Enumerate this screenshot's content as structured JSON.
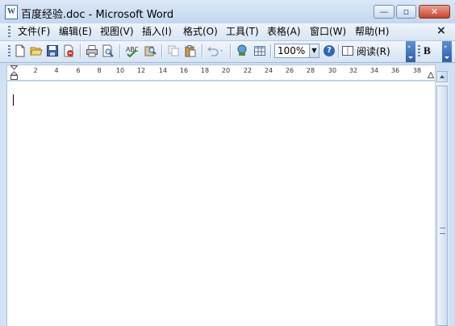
{
  "window": {
    "app_icon_letter": "W",
    "title": "百度经验.doc - Microsoft Word",
    "min_glyph": "—",
    "max_glyph": "▫",
    "close_glyph": "✕"
  },
  "menu": {
    "items": [
      "文件(F)",
      "编辑(E)",
      "视图(V)",
      "插入(I)",
      "格式(O)",
      "工具(T)",
      "表格(A)",
      "窗口(W)",
      "帮助(H)"
    ],
    "close_glyph": "×"
  },
  "toolbar": {
    "zoom_value": "100%",
    "zoom_arrow": "▼",
    "help_glyph": "?",
    "read_label": "阅读(R)",
    "bold_label": "B",
    "icons": [
      "new-document-icon",
      "open-icon",
      "save-icon",
      "permission-icon",
      "print-icon",
      "print-preview-icon",
      "spelling-icon",
      "research-icon",
      "copy-icon",
      "paste-icon",
      "undo-icon",
      "hyperlink-icon",
      "table-icon"
    ]
  },
  "ruler": {
    "ticks": [
      "2",
      "4",
      "6",
      "8",
      "10",
      "12",
      "14",
      "16",
      "18",
      "20",
      "22",
      "24",
      "26",
      "28",
      "30",
      "32",
      "34",
      "36",
      "38"
    ]
  },
  "document": {
    "content": ""
  },
  "colors": {
    "title_bar": "#c3d7ef",
    "close_button": "#c5442e",
    "toolbar_end": "#2d5fa8"
  }
}
